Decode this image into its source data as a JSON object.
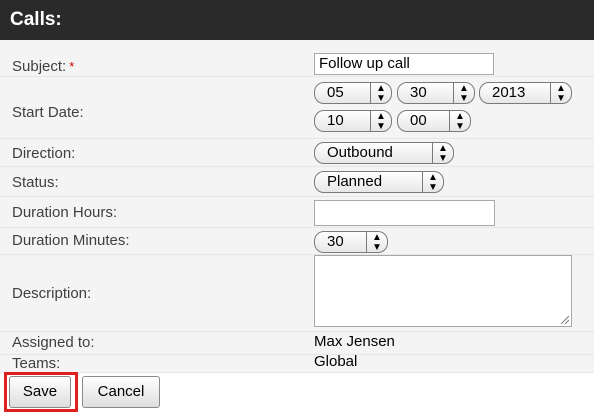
{
  "header": {
    "title": "Calls:"
  },
  "fields": {
    "subject": {
      "label": "Subject:",
      "required_mark": "*",
      "value": "Follow up call"
    },
    "start_date": {
      "label": "Start Date:",
      "month": "05",
      "day": "30",
      "year": "2013",
      "hour": "10",
      "minute": "00"
    },
    "direction": {
      "label": "Direction:",
      "value": "Outbound"
    },
    "status": {
      "label": "Status:",
      "value": "Planned"
    },
    "duration_hours": {
      "label": "Duration Hours:",
      "value": ""
    },
    "duration_minutes": {
      "label": "Duration Minutes:",
      "value": "30"
    },
    "description": {
      "label": "Description:",
      "value": ""
    },
    "assigned_to": {
      "label": "Assigned to:",
      "value": "Max Jensen"
    },
    "teams": {
      "label": "Teams:",
      "value": "Global"
    }
  },
  "actions": {
    "save_label": "Save",
    "cancel_label": "Cancel"
  },
  "colors": {
    "header_bg": "#2a2a2a",
    "required": "#cc0000",
    "save_highlight": "#e02020"
  }
}
